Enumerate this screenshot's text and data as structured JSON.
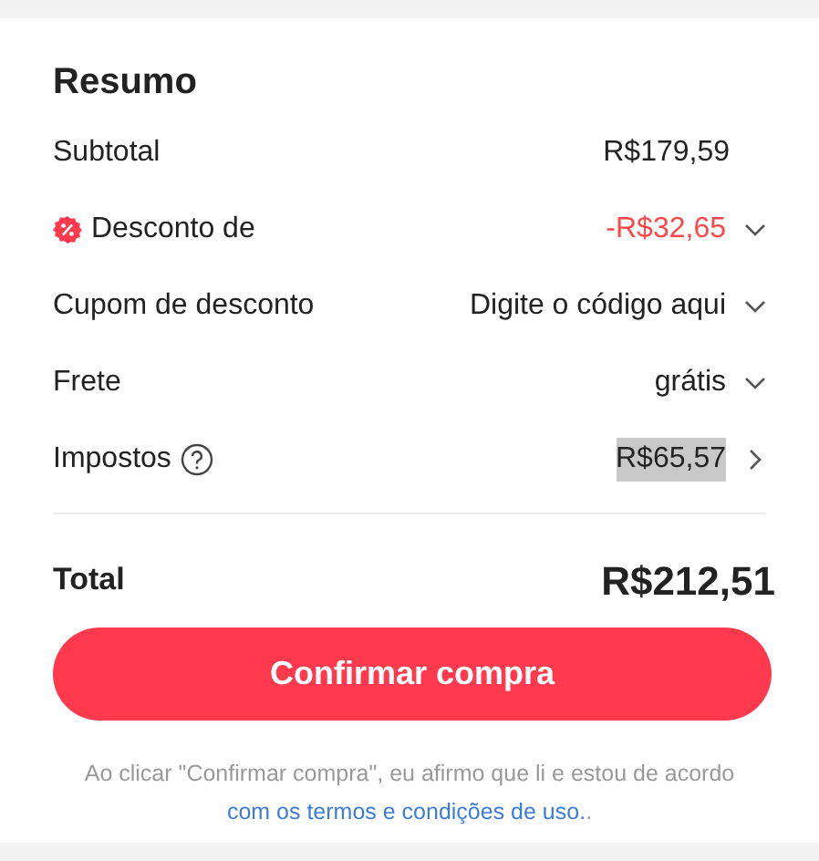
{
  "title": "Resumo",
  "rows": [
    {
      "kind": "amount",
      "label": "Subtotal",
      "value": "R$179,59",
      "highlighted": false
    },
    {
      "kind": "discount",
      "label": "Desconto de",
      "value": "-R$32,65",
      "highlighted": false
    },
    {
      "kind": "dropdown",
      "label": "Cupom de desconto",
      "value": "Digite o código aqui",
      "highlighted": false
    },
    {
      "kind": "dropdown",
      "label": "Frete",
      "value": "grátis",
      "highlighted": false
    },
    {
      "kind": "tax",
      "label": "Impostos",
      "value": "R$65,57",
      "highlighted": true
    }
  ],
  "total": {
    "label": "Total",
    "value": "R$212,51"
  },
  "confirm_button": "Confirmar compra",
  "footer": {
    "text": "Ao clicar \"Confirmar compra\", eu afirmo que li e estou de acordo",
    "link": "com os termos e condições de uso.",
    "suffix": "."
  }
}
